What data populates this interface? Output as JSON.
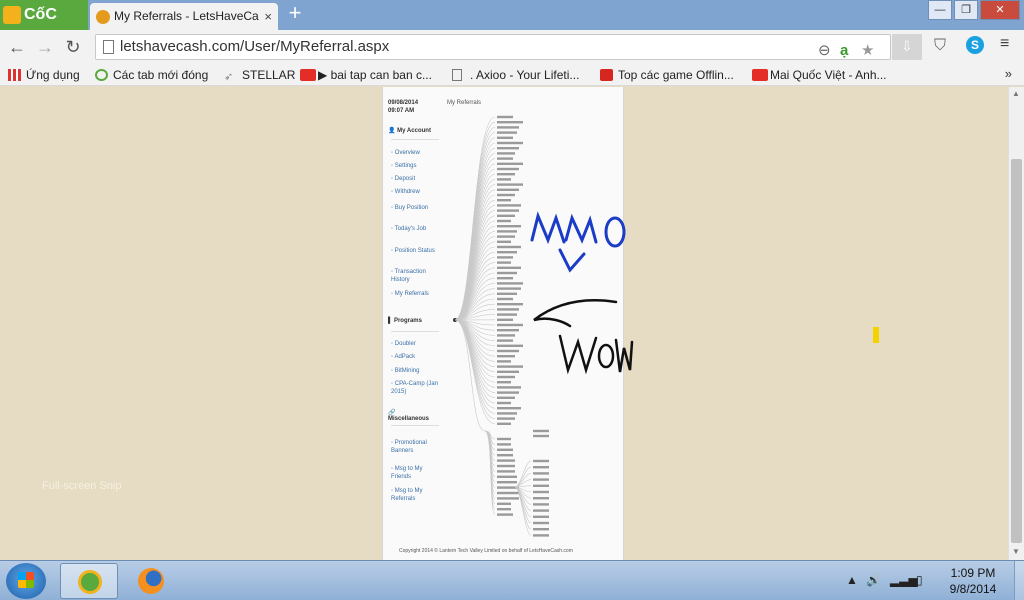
{
  "browser": {
    "brand": "CốC CốC",
    "tab_title": "My Referrals - LetsHaveCa",
    "tab_close": "×",
    "new_tab": "+",
    "url": "letshavecash.com/User/MyReferral.aspx",
    "window_minimize": "—",
    "window_restore": "❐",
    "window_close": "✕"
  },
  "bookmarks": [
    {
      "label": "Ứng dụng",
      "icon": "apps-grid-icon"
    },
    {
      "label": "Các tab mới đóng",
      "icon": "history-icon"
    },
    {
      "label": "STELLAR",
      "icon": "rocket-icon"
    },
    {
      "label": "▶ bai tap can ban c...",
      "icon": "youtube-icon"
    },
    {
      "label": ". Axioo - Your Lifeti...",
      "icon": "page-icon"
    },
    {
      "label": "Top các game Offlin...",
      "icon": "game-icon"
    },
    {
      "label": "Mai Quốc Việt - Anh...",
      "icon": "youtube-icon"
    }
  ],
  "bookmarks_more": "»",
  "sidebar": {
    "datetime": "09/08/2014\n09:07 AM",
    "sections": {
      "account": "My Account",
      "programs": "Programs",
      "misc": "Miscellaneous"
    },
    "account_items": [
      "Overview",
      "Settings",
      "Deposit",
      "Withdrew",
      "Buy Position",
      "Today's Job",
      "Position Status",
      "Transaction History",
      "My Referrals"
    ],
    "program_items": [
      "Doubler",
      "AdPack",
      "BitMining",
      "CPA-Camp (Jan 2015)"
    ],
    "misc_items": [
      "Promotional Banners",
      "Msg to My Friends",
      "Msg to My Referrals"
    ]
  },
  "page": {
    "title": "My Referrals",
    "copyright": "Copyright 2014 © Lantern Tech Valley Limited on behalf of LetsHaveCash.com"
  },
  "annotations": {
    "text1": "MMO",
    "text2": "WOW",
    "overlay": "Full-screen Snip"
  },
  "taskbar": {
    "time": "1:09 PM",
    "date": "9/8/2014"
  },
  "colors": {
    "page_bg": "#e6dcc3",
    "link": "#3a6fa6",
    "ink_blue": "#1a3cc7"
  }
}
